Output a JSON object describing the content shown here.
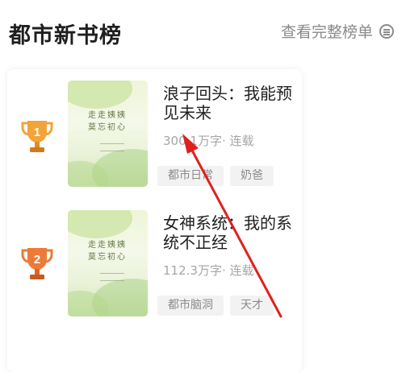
{
  "header": {
    "title": "都市新书榜",
    "view_all_label": "查看完整榜单",
    "view_all_icon": "menu-circle-icon"
  },
  "books": [
    {
      "rank": "1",
      "title": "浪子回头：我能预见未来",
      "meta": "300.1万字· 连载",
      "tags": [
        "都市日常",
        "奶爸"
      ],
      "cover_text": "走走姨姨 莫忘初心",
      "trophy_color": "#e8932a"
    },
    {
      "rank": "2",
      "title": "女神系统：我的系统不正经",
      "meta": "112.3万字· 连载",
      "tags": [
        "都市脑洞",
        "天才"
      ],
      "cover_text": "走走姨姨 莫忘初心",
      "trophy_color": "#e86a2a"
    }
  ],
  "annotation": {
    "type": "red-arrow",
    "color": "#e0201e"
  }
}
